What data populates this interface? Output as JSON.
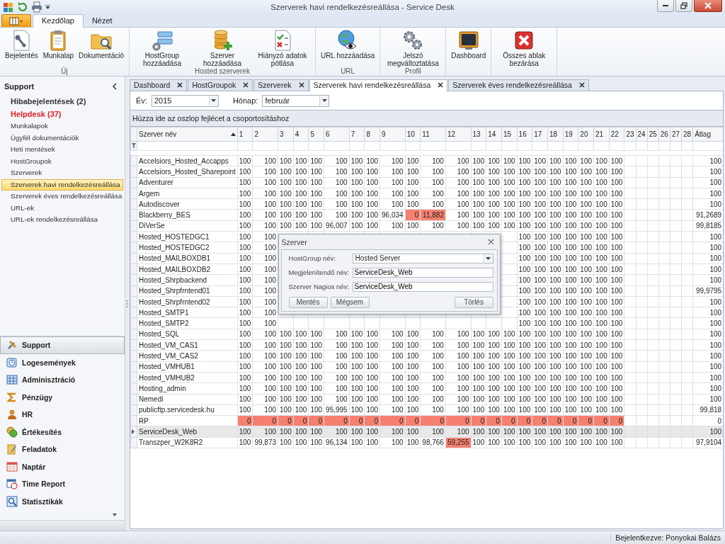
{
  "window": {
    "title": "Szerverek havi rendelkezésreállása - Service Desk"
  },
  "ribbon_tabs": [
    {
      "label": "Kezdőlap",
      "selected": true
    },
    {
      "label": "Nézet",
      "selected": false
    }
  ],
  "ribbon_groups": [
    {
      "label": "Új",
      "buttons": [
        "Bejelentés",
        "Munkalap",
        "Dokumentáció"
      ]
    },
    {
      "label": "Hosted szerverek",
      "buttons": [
        "HostGroup hozzáadása",
        "Szerver hozzáadása",
        "Hiányzó adatok pótlása"
      ]
    },
    {
      "label": "URL",
      "buttons": [
        "URL hozzáadása"
      ]
    },
    {
      "label": "Profil",
      "buttons": [
        "Jelszó megváltoztatása"
      ]
    },
    {
      "buttons": [
        "Dashboard"
      ]
    },
    {
      "buttons": [
        "Összes ablak bezárása"
      ]
    }
  ],
  "sidebar": {
    "title": "Support",
    "items": [
      {
        "label": "Hibabejelentések (2)",
        "kind": "count",
        "selected": false
      },
      {
        "label": "Helpdesk (37)",
        "kind": "alert",
        "selected": false
      },
      {
        "label": "Munkalapok",
        "kind": "link",
        "selected": false
      },
      {
        "label": "Ügyfél dokumentációk",
        "kind": "link",
        "selected": false
      },
      {
        "label": "Heti mentések",
        "kind": "link",
        "selected": false
      },
      {
        "label": "HostGroupok",
        "kind": "link",
        "selected": false
      },
      {
        "label": "Szerverek",
        "kind": "link",
        "selected": false
      },
      {
        "label": "Szerverek havi rendelkezésreállása",
        "kind": "link",
        "selected": true
      },
      {
        "label": "Szerverek éves rendelkezésreállása",
        "kind": "link",
        "selected": false
      },
      {
        "label": "URL-ek",
        "kind": "link",
        "selected": false
      },
      {
        "label": "URL-ek rendelkezésreállása",
        "kind": "link",
        "selected": false
      }
    ],
    "nav_groups": [
      {
        "label": "Support",
        "selected": true
      },
      {
        "label": "Logesemények",
        "selected": false
      },
      {
        "label": "Adminisztráció",
        "selected": false
      },
      {
        "label": "Pénzügy",
        "selected": false
      },
      {
        "label": "HR",
        "selected": false
      },
      {
        "label": "Értékesítés",
        "selected": false
      },
      {
        "label": "Feladatok",
        "selected": false
      },
      {
        "label": "Naptár",
        "selected": false
      },
      {
        "label": "Time Report",
        "selected": false
      },
      {
        "label": "Statisztikák",
        "selected": false
      }
    ]
  },
  "document_tabs": [
    {
      "label": "Dashboard",
      "selected": false
    },
    {
      "label": "HostGroupok",
      "selected": false
    },
    {
      "label": "Szerverek",
      "selected": false
    },
    {
      "label": "Szerverek havi rendelkezésreállása",
      "selected": true
    },
    {
      "label": "Szerverek éves rendelkezésreállása",
      "selected": false
    }
  ],
  "filters": [
    {
      "label": "Év:",
      "value": "2015"
    },
    {
      "label": "Hónap:",
      "value": "február"
    }
  ],
  "group_panel": "Húzza ide az oszlop fejlécet a csoportosításhoz",
  "grid": {
    "name_column": {
      "label": "Szerver név",
      "sort_ascending": true
    },
    "day_columns": [
      "1",
      "2",
      "3",
      "4",
      "5",
      "6",
      "7",
      "8",
      "9",
      "10",
      "11",
      "12",
      "13",
      "14",
      "15",
      "16",
      "17",
      "18",
      "19",
      "20",
      "21",
      "22",
      "23",
      "24",
      "25",
      "26",
      "27",
      "28"
    ],
    "average_column": "Átlag",
    "rows": [
      {
        "name": "Accelsiors_Hosted_Accapps",
        "selected": false,
        "cells": [
          "100",
          "100",
          "100",
          "100",
          "100",
          "100",
          "100",
          "100",
          "100",
          "100",
          "100",
          "100",
          "100",
          "100",
          "100",
          "100",
          "100",
          "100",
          "100",
          "100",
          "100",
          "100"
        ],
        "average": "100"
      },
      {
        "name": "Accelsiors_Hosted_Sharepoint",
        "selected": false,
        "cells": [
          "100",
          "100",
          "100",
          "100",
          "100",
          "100",
          "100",
          "100",
          "100",
          "100",
          "100",
          "100",
          "100",
          "100",
          "100",
          "100",
          "100",
          "100",
          "100",
          "100",
          "100",
          "100"
        ],
        "average": "100"
      },
      {
        "name": "Adventurer",
        "selected": false,
        "cells": [
          "100",
          "100",
          "100",
          "100",
          "100",
          "100",
          "100",
          "100",
          "100",
          "100",
          "100",
          "100",
          "100",
          "100",
          "100",
          "100",
          "100",
          "100",
          "100",
          "100",
          "100",
          "100"
        ],
        "average": "100"
      },
      {
        "name": "Argem",
        "selected": false,
        "cells": [
          "100",
          "100",
          "100",
          "100",
          "100",
          "100",
          "100",
          "100",
          "100",
          "100",
          "100",
          "100",
          "100",
          "100",
          "100",
          "100",
          "100",
          "100",
          "100",
          "100",
          "100",
          "100"
        ],
        "average": "100"
      },
      {
        "name": "Autodiscover",
        "selected": false,
        "cells": [
          "100",
          "100",
          "100",
          "100",
          "100",
          "100",
          "100",
          "100",
          "100",
          "100",
          "100",
          "100",
          "100",
          "100",
          "100",
          "100",
          "100",
          "100",
          "100",
          "100",
          "100",
          "100"
        ],
        "average": "100"
      },
      {
        "name": "Blackberry_BES",
        "selected": false,
        "cells": [
          "100",
          "100",
          "100",
          "100",
          "100",
          "100",
          "100",
          "100",
          "96,034",
          {
            "value": "0",
            "flagged": true
          },
          {
            "value": "11,882",
            "flagged": true
          },
          "100",
          "100",
          "100",
          "100",
          "100",
          "100",
          "100",
          "100",
          "100",
          "100",
          "100"
        ],
        "average": "91,2689"
      },
      {
        "name": "DiVerSe",
        "selected": false,
        "cells": [
          "100",
          "100",
          "100",
          "100",
          "100",
          "96,007",
          "100",
          "100",
          "100",
          "100",
          "100",
          "100",
          "100",
          "100",
          "100",
          "100",
          "100",
          "100",
          "100",
          "100",
          "100",
          "100"
        ],
        "average": "99,8185"
      },
      {
        "name": "Hosted_HOSTEDGC1",
        "selected": false,
        "cells": [
          "100",
          "100",
          null,
          null,
          null,
          null,
          null,
          null,
          null,
          null,
          null,
          null,
          null,
          null,
          null,
          "100",
          "100",
          "100",
          "100",
          "100",
          "100",
          "100"
        ],
        "average": "100"
      },
      {
        "name": "Hosted_HOSTEDGC2",
        "selected": false,
        "cells": [
          "100",
          "100",
          null,
          null,
          null,
          null,
          null,
          null,
          null,
          null,
          null,
          null,
          null,
          null,
          null,
          "100",
          "100",
          "100",
          "100",
          "100",
          "100",
          "100"
        ],
        "average": "100"
      },
      {
        "name": "Hosted_MAILBOXDB1",
        "selected": false,
        "cells": [
          "100",
          "100",
          null,
          null,
          null,
          null,
          null,
          null,
          null,
          null,
          null,
          null,
          null,
          null,
          null,
          "100",
          "100",
          "100",
          "100",
          "100",
          "100",
          "100"
        ],
        "average": "100"
      },
      {
        "name": "Hosted_MAILBOXDB2",
        "selected": false,
        "cells": [
          "100",
          "100",
          null,
          null,
          null,
          null,
          null,
          null,
          null,
          null,
          null,
          null,
          null,
          null,
          null,
          "100",
          "100",
          "100",
          "100",
          "100",
          "100",
          "100"
        ],
        "average": "100"
      },
      {
        "name": "Hosted_Shrpbackend",
        "selected": false,
        "cells": [
          "100",
          "100",
          null,
          null,
          null,
          null,
          null,
          null,
          null,
          null,
          null,
          null,
          null,
          null,
          null,
          "100",
          "100",
          "100",
          "100",
          "100",
          "100",
          "100"
        ],
        "average": "100"
      },
      {
        "name": "Hosted_Shrpfrntend01",
        "selected": false,
        "cells": [
          "100",
          "100",
          null,
          null,
          null,
          null,
          null,
          null,
          null,
          null,
          null,
          null,
          null,
          null,
          null,
          "100",
          "100",
          "100",
          "100",
          "100",
          "100",
          "100"
        ],
        "average": "99,9795"
      },
      {
        "name": "Hosted_Shrpfrntend02",
        "selected": false,
        "cells": [
          "100",
          "100",
          null,
          null,
          null,
          null,
          null,
          null,
          null,
          null,
          null,
          null,
          null,
          null,
          null,
          "100",
          "100",
          "100",
          "100",
          "100",
          "100",
          "100"
        ],
        "average": "100"
      },
      {
        "name": "Hosted_SMTP1",
        "selected": false,
        "cells": [
          "100",
          "100",
          null,
          null,
          null,
          null,
          null,
          null,
          null,
          null,
          null,
          null,
          null,
          null,
          null,
          "100",
          "100",
          "100",
          "100",
          "100",
          "100",
          "100"
        ],
        "average": "100"
      },
      {
        "name": "Hosted_SMTP2",
        "selected": false,
        "cells": [
          "100",
          "100",
          null,
          null,
          null,
          null,
          null,
          null,
          null,
          null,
          null,
          null,
          null,
          null,
          null,
          "100",
          "100",
          "100",
          "100",
          "100",
          "100",
          "100"
        ],
        "average": "100"
      },
      {
        "name": "Hosted_SQL",
        "selected": false,
        "cells": [
          "100",
          "100",
          "100",
          "100",
          "100",
          "100",
          "100",
          "100",
          "100",
          "100",
          "100",
          "100",
          "100",
          "100",
          "100",
          "100",
          "100",
          "100",
          "100",
          "100",
          "100",
          "100"
        ],
        "average": "100"
      },
      {
        "name": "Hosted_VM_CAS1",
        "selected": false,
        "cells": [
          "100",
          "100",
          "100",
          "100",
          "100",
          "100",
          "100",
          "100",
          "100",
          "100",
          "100",
          "100",
          "100",
          "100",
          "100",
          "100",
          "100",
          "100",
          "100",
          "100",
          "100",
          "100"
        ],
        "average": "100"
      },
      {
        "name": "Hosted_VM_CAS2",
        "selected": false,
        "cells": [
          "100",
          "100",
          "100",
          "100",
          "100",
          "100",
          "100",
          "100",
          "100",
          "100",
          "100",
          "100",
          "100",
          "100",
          "100",
          "100",
          "100",
          "100",
          "100",
          "100",
          "100",
          "100"
        ],
        "average": "100"
      },
      {
        "name": "Hosted_VMHUB1",
        "selected": false,
        "cells": [
          "100",
          "100",
          "100",
          "100",
          "100",
          "100",
          "100",
          "100",
          "100",
          "100",
          "100",
          "100",
          "100",
          "100",
          "100",
          "100",
          "100",
          "100",
          "100",
          "100",
          "100",
          "100"
        ],
        "average": "100"
      },
      {
        "name": "Hosted_VMHUB2",
        "selected": false,
        "cells": [
          "100",
          "100",
          "100",
          "100",
          "100",
          "100",
          "100",
          "100",
          "100",
          "100",
          "100",
          "100",
          "100",
          "100",
          "100",
          "100",
          "100",
          "100",
          "100",
          "100",
          "100",
          "100"
        ],
        "average": "100"
      },
      {
        "name": "Hosting_admin",
        "selected": false,
        "cells": [
          "100",
          "100",
          "100",
          "100",
          "100",
          "100",
          "100",
          "100",
          "100",
          "100",
          "100",
          "100",
          "100",
          "100",
          "100",
          "100",
          "100",
          "100",
          "100",
          "100",
          "100",
          "100"
        ],
        "average": "100"
      },
      {
        "name": "Nemedi",
        "selected": false,
        "cells": [
          "100",
          "100",
          "100",
          "100",
          "100",
          "100",
          "100",
          "100",
          "100",
          "100",
          "100",
          "100",
          "100",
          "100",
          "100",
          "100",
          "100",
          "100",
          "100",
          "100",
          "100",
          "100"
        ],
        "average": "100"
      },
      {
        "name": "publicftp.servicedesk.hu",
        "selected": false,
        "cells": [
          "100",
          "100",
          "100",
          "100",
          "100",
          "95,995",
          "100",
          "100",
          "100",
          "100",
          "100",
          "100",
          "100",
          "100",
          "100",
          "100",
          "100",
          "100",
          "100",
          "100",
          "100",
          "100"
        ],
        "average": "99,818"
      },
      {
        "name": "RP",
        "selected": false,
        "cells": [
          {
            "value": "0",
            "flagged": true
          },
          {
            "value": "0",
            "flagged": true
          },
          {
            "value": "0",
            "flagged": true
          },
          {
            "value": "0",
            "flagged": true
          },
          {
            "value": "0",
            "flagged": true
          },
          {
            "value": "0",
            "flagged": true
          },
          {
            "value": "0",
            "flagged": true
          },
          {
            "value": "0",
            "flagged": true
          },
          {
            "value": "0",
            "flagged": true
          },
          {
            "value": "0",
            "flagged": true
          },
          {
            "value": "0",
            "flagged": true
          },
          {
            "value": "0",
            "flagged": true
          },
          {
            "value": "0",
            "flagged": true
          },
          {
            "value": "0",
            "flagged": true
          },
          {
            "value": "0",
            "flagged": true
          },
          {
            "value": "0",
            "flagged": true
          },
          {
            "value": "0",
            "flagged": true
          },
          {
            "value": "0",
            "flagged": true
          },
          {
            "value": "0",
            "flagged": true
          },
          {
            "value": "0",
            "flagged": true
          },
          {
            "value": "0",
            "flagged": true
          },
          {
            "value": "0",
            "flagged": true
          }
        ],
        "average": "0"
      },
      {
        "name": "ServiceDesk_Web",
        "selected": true,
        "cells": [
          "100",
          "100",
          "100",
          "100",
          "100",
          "100",
          "100",
          "100",
          "100",
          "100",
          "100",
          "100",
          "100",
          "100",
          "100",
          "100",
          "100",
          "100",
          "100",
          "100",
          "100",
          "100"
        ],
        "average": "100"
      },
      {
        "name": "Transzper_W2K8R2",
        "selected": false,
        "cells": [
          "100",
          "99,873",
          "100",
          "100",
          "100",
          "96,134",
          "100",
          "100",
          "100",
          "100",
          "98,766",
          {
            "value": "59,255",
            "flagged": true
          },
          "100",
          "100",
          "100",
          "100",
          "100",
          "100",
          "100",
          "100",
          "100",
          "100"
        ],
        "average": "97,9104"
      }
    ]
  },
  "dialog": {
    "title": "Szerver",
    "fields": [
      {
        "label": "HostGroup név:",
        "value": "Hosted Server",
        "kind": "combo"
      },
      {
        "label": "Megjelenítendő név:",
        "value": "ServiceDesk_Web",
        "kind": "text"
      },
      {
        "label": "Szerver Nagios név:",
        "value": "ServiceDesk_Web",
        "kind": "text"
      }
    ],
    "buttons": [
      "Mentés",
      "Mégsem",
      "Törlés"
    ]
  },
  "status_bar": {
    "text": "Bejelentkezve: Ponyokai Balázs"
  }
}
